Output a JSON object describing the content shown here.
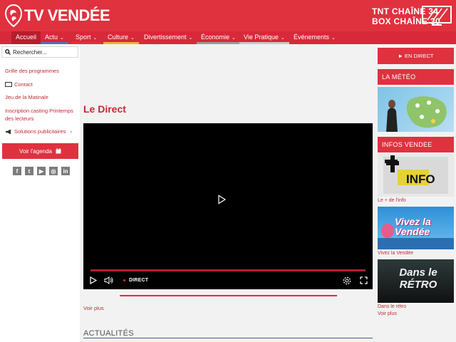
{
  "header": {
    "logo_text": "TV VENDÉE",
    "channels": [
      "TNT CHAÎNE 34",
      "BOX CHAÎNE 30"
    ]
  },
  "nav": [
    {
      "label": "Accueil",
      "caret": false,
      "color": ""
    },
    {
      "label": "Actu",
      "caret": true,
      "color": "#5a6fb0"
    },
    {
      "label": "Sport",
      "caret": true,
      "color": "#e0313f"
    },
    {
      "label": "Culture",
      "caret": true,
      "color": "#f2b233"
    },
    {
      "label": "Divertissement",
      "caret": true,
      "color": "#d8293a"
    },
    {
      "label": "Économie",
      "caret": true,
      "color": "#9a9aa0"
    },
    {
      "label": "Vie Pratique",
      "caret": true,
      "color": "#c8c8c8"
    },
    {
      "label": "Événements",
      "caret": true,
      "color": "#d8293a"
    }
  ],
  "sidebar": {
    "search_placeholder": "Rechercher...",
    "links": [
      {
        "label": "Grille des programmes"
      },
      {
        "label": "Contact"
      },
      {
        "label": "Jeu de la Matinale"
      },
      {
        "label": "Inscription casting Printemps des lecteurs"
      },
      {
        "label": "Solutions publicitaires"
      }
    ],
    "agenda_label": "Voir l'agenda",
    "socials": [
      "f",
      "t",
      "▶",
      "◎",
      "in"
    ]
  },
  "main": {
    "title": "Le Direct",
    "player_status": "DIRECT",
    "more_link": "Voir plus",
    "section_title": "ACTUALITÉS"
  },
  "right": {
    "live_button": "► EN DIRECT",
    "weather_title": "LA MÉTÉO",
    "news_title": "INFOS VENDEE",
    "items": [
      {
        "caption": "Le + de l'info",
        "thumb_text": "INFO"
      },
      {
        "caption": "Vivez la Vendée",
        "thumb_text": "Vivez la Vendée"
      },
      {
        "caption": "Dans le rétro",
        "thumb_text": "Dans le RÉTRO"
      }
    ],
    "more_link": "Voir plus"
  },
  "colors": {
    "brand_red": "#e0313f",
    "link_red": "#c62835"
  }
}
